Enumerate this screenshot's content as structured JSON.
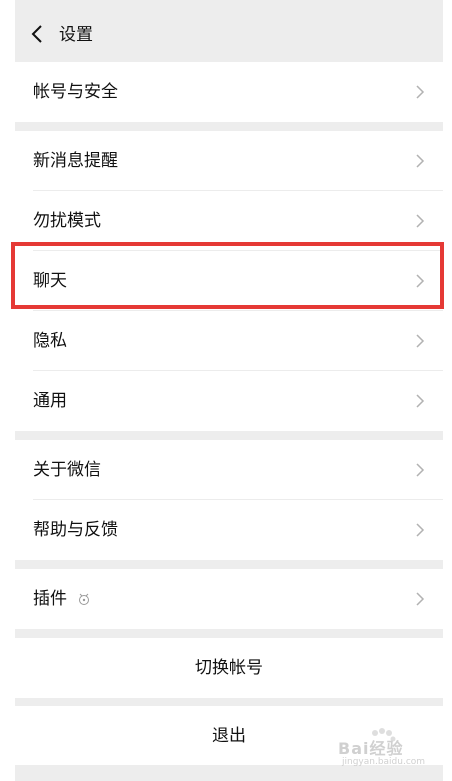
{
  "header": {
    "title": "设置",
    "back_icon": "chevron-left-icon"
  },
  "groups": [
    {
      "items": [
        {
          "label": "帐号与安全"
        }
      ]
    },
    {
      "items": [
        {
          "label": "新消息提醒"
        },
        {
          "label": "勿扰模式"
        },
        {
          "label": "聊天"
        },
        {
          "label": "隐私"
        },
        {
          "label": "通用"
        }
      ]
    },
    {
      "items": [
        {
          "label": "关于微信"
        },
        {
          "label": "帮助与反馈"
        }
      ]
    },
    {
      "items": [
        {
          "label": "插件",
          "icon": "plugin-icon"
        }
      ]
    }
  ],
  "actions": {
    "switch_account": "切换帐号",
    "logout": "退出"
  },
  "highlight": {
    "target": "聊天",
    "color": "#e53935"
  },
  "watermark": {
    "text": "Bai经验",
    "sub": "jingyan.baidu.com"
  },
  "colors": {
    "background": "#ededed",
    "cell": "#ffffff",
    "chevron": "#b2b2b2",
    "text": "#111111"
  }
}
